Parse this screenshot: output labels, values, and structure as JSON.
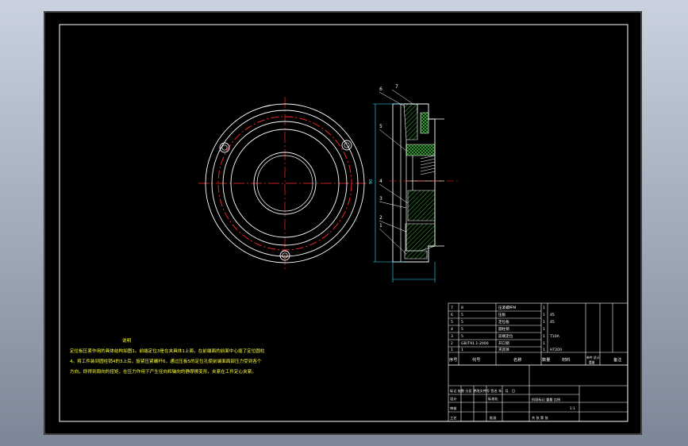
{
  "colors": {
    "sheet": "#000000",
    "frame": "#ffffff",
    "centerline": "#ff2b2b",
    "hatch": "#3cd23c",
    "note_text": "#ffff3a",
    "dimension": "#35e0ff",
    "table_text": "#ffffff"
  },
  "notes": {
    "title": "说明",
    "body": "定位板压紧作用的具体结构如图1。前端定位3是在夹具体1上面，在前端面的前面中心插了定位圆柱4。将工件装到圆柱销4的3上后，旋紧压紧螺杆6，通过压板5的定位孔使前端面面部压力受到各个方向，即得到周向的扭矩，在压力作用下产生径向和轴向的静摩擦变形，夹紧在工件定心夹紧。"
  },
  "part_callouts": [
    "6",
    "7",
    "5",
    "4",
    "3",
    "2",
    "1"
  ],
  "dimension_label": "90",
  "bom": {
    "rows": [
      {
        "no": "7",
        "code": "8",
        "name": "压紧螺杆M",
        "qty": "1",
        "material": ""
      },
      {
        "no": "6",
        "code": "5",
        "name": "压板",
        "qty": "1",
        "material": "45"
      },
      {
        "no": "5",
        "code": "5",
        "name": "定位板",
        "qty": "1",
        "material": "45"
      },
      {
        "no": "4",
        "code": "5",
        "name": "圆柱销",
        "qty": "1",
        "material": ""
      },
      {
        "no": "3",
        "code": "5",
        "name": "前端定位",
        "qty": "1",
        "material": "T10A"
      },
      {
        "no": "2",
        "code": "GB/T91.1-2000",
        "name": "开口销",
        "qty": "1",
        "material": ""
      },
      {
        "no": "1",
        "code": "1",
        "name": "夹具体",
        "qty": "1",
        "material": "HT200"
      }
    ],
    "header": {
      "no": "序号",
      "code": "代号",
      "name": "名称",
      "qty": "数量",
      "material": "材料",
      "unit_total": "单件 总计",
      "weight": "重量",
      "remark": "备注"
    }
  },
  "title_block": {
    "rev_row": "标记 处数 分区 更改文件号 签名 年、月、日",
    "design": "设计",
    "standard": "标准化",
    "review": "审核",
    "process": "工艺",
    "approve": "批准",
    "stage_cols": "阶段标记 重量 比例",
    "scale": "1:1",
    "sheet": "共 张 第 张"
  }
}
